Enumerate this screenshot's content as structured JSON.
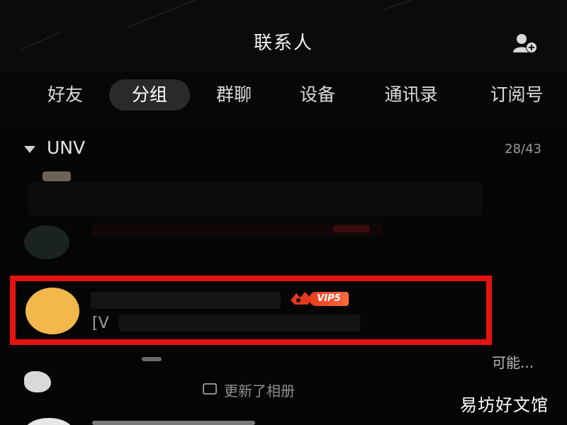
{
  "header": {
    "title": "联系人",
    "add_contact_icon": "add-contact-icon"
  },
  "tabs": [
    {
      "label": "好友",
      "active": false
    },
    {
      "label": "分组",
      "active": true
    },
    {
      "label": "群聊",
      "active": false
    },
    {
      "label": "设备",
      "active": false
    },
    {
      "label": "通讯录",
      "active": false
    },
    {
      "label": "订阅号",
      "active": false
    }
  ],
  "group": {
    "name": "UNV",
    "count": "28/43",
    "expand_icon": "caret-down-icon"
  },
  "contacts": {
    "first_partial_text": "可能...",
    "highlighted_badge": "VIP5",
    "highlighted_preview_prefix": "[V",
    "update_text": "更新了相册"
  },
  "watermark": "易坊好文馆",
  "colors": {
    "highlight_border": "#e51212",
    "vip_badge": "#e83a1f",
    "avatar_highlighted": "#f2b84b",
    "background": "#050505"
  }
}
